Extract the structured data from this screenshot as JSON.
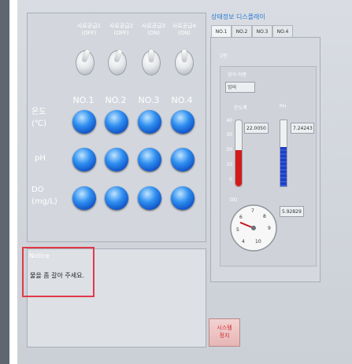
{
  "supply": {
    "labels": [
      "사료공급1\n(OFF)",
      "사료공급2\n(OFF)",
      "사료공급3\n(ON)",
      "사료공급4\n(ON)"
    ]
  },
  "channels": [
    "NO.1",
    "NO.2",
    "NO.3",
    "NO.4"
  ],
  "rows": {
    "temp": "온도\n(℃)",
    "ph": "pH",
    "do": "DO\n(mg/L)"
  },
  "notice": {
    "title": "Notice",
    "message": "물을 좀 갈아 주세요."
  },
  "status": {
    "title": "상태정보 디스플레이",
    "tabs": [
      "NO.1",
      "NO.2",
      "NO.3",
      "NO.4"
    ],
    "section": "1번",
    "feed_label": "양식 어종",
    "feed_value": "잉어",
    "thermo_label": "온도계",
    "ph_label": "PH",
    "temp_value": "22.0050",
    "ph_value": "7.24243",
    "do_label": "DO",
    "do_value": "5.92829",
    "thermo_ticks": [
      "40",
      "30",
      "20",
      "10",
      "0"
    ],
    "dial_ticks": [
      "4",
      "5",
      "6",
      "7",
      "8",
      "9",
      "10"
    ],
    "temp_level_fraction": 0.55,
    "ph_level_fraction": 0.6
  },
  "stop_button": "시스템\n정지",
  "colors": {
    "led": "#2f8ff0",
    "notice_border": "#e1394a",
    "thermo_fill": "#d21b1b",
    "title_blue": "#2a7ad3"
  }
}
